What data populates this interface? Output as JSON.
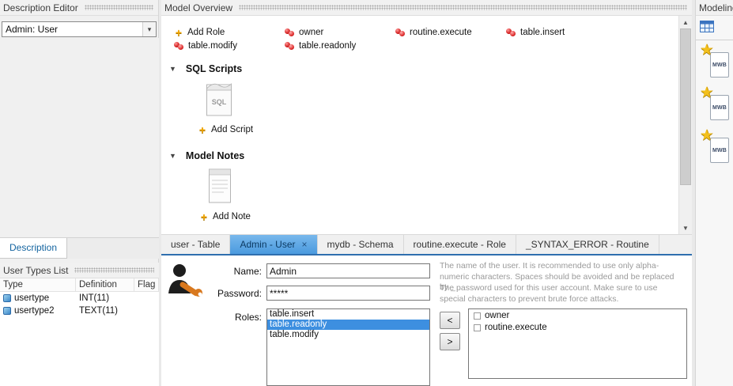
{
  "icons": {
    "add": "+",
    "collapse": "▼",
    "close": "×",
    "dropdown": "▾",
    "scroll_up": "▲",
    "scroll_down": "▼",
    "star": "★"
  },
  "colors": {
    "selection_blue": "#3d8fe0",
    "active_tab_blue": "#4a9ade",
    "separator_blue": "#2f6fae",
    "role_icon_red": "#d42020",
    "add_icon_yellow": "#f0a500"
  },
  "left_panel": {
    "description_editor": {
      "title": "Description Editor",
      "dropdown_value": "Admin: User"
    },
    "tabs": [
      {
        "label": "Description",
        "active": true
      }
    ],
    "user_types": {
      "title": "User Types List",
      "columns": [
        "Type",
        "Definition",
        "Flag"
      ],
      "rows": [
        {
          "type": "usertype",
          "definition": "INT(11)"
        },
        {
          "type": "usertype2",
          "definition": "TEXT(11)"
        }
      ]
    }
  },
  "model_overview": {
    "title": "Model Overview",
    "roles": [
      {
        "label": "Add Role",
        "kind": "add"
      },
      {
        "label": "owner",
        "kind": "role"
      },
      {
        "label": "routine.execute",
        "kind": "role"
      },
      {
        "label": "table.insert",
        "kind": "role"
      },
      {
        "label": "table.modify",
        "kind": "role"
      },
      {
        "label": "table.readonly",
        "kind": "role"
      }
    ],
    "sql_scripts": {
      "title": "SQL Scripts",
      "icon_text": "SQL",
      "add_label": "Add Script"
    },
    "model_notes": {
      "title": "Model Notes",
      "add_label": "Add Note"
    }
  },
  "editor_tabs": [
    {
      "label": "user - Table",
      "active": false
    },
    {
      "label": "Admin - User",
      "active": true
    },
    {
      "label": "mydb - Schema",
      "active": false
    },
    {
      "label": "routine.execute - Role",
      "active": false
    },
    {
      "label": "_SYNTAX_ERROR - Routine",
      "active": false
    }
  ],
  "user_editor": {
    "name_label": "Name:",
    "name_value": "Admin",
    "name_help": "The name of the user. It is recommended to use only alpha-numeric characters. Spaces should be avoided and be replaced by _",
    "password_label": "Password:",
    "password_value": "*****",
    "password_help": "The password used for this user account. Make sure to use special characters to prevent brute force attacks.",
    "roles_label": "Roles:",
    "assigned_roles": [
      "table.insert",
      "table.readonly",
      "table.modify"
    ],
    "selected_assigned_role": "table.readonly",
    "available_roles": [
      "owner",
      "routine.execute"
    ],
    "remove_button": "<",
    "add_button": ">"
  },
  "right_panel": {
    "title": "Modeling",
    "mwb_label": "MWB"
  }
}
